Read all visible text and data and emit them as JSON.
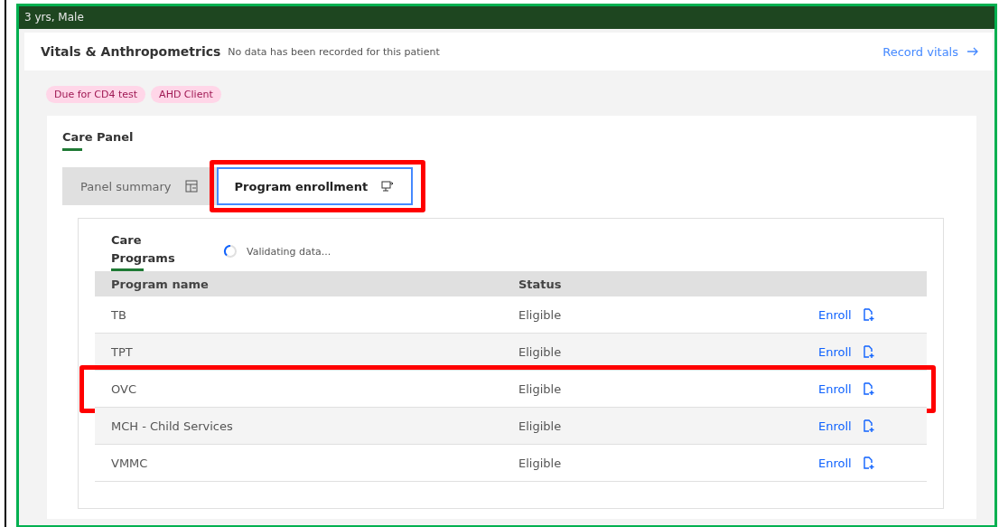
{
  "patient_banner": {
    "text": "3 yrs, Male"
  },
  "vitals": {
    "title": "Vitals & Anthropometrics",
    "message": "No data has been recorded for this patient",
    "link": "Record vitals"
  },
  "tags": [
    {
      "label": "Due for CD4 test"
    },
    {
      "label": "AHD Client"
    }
  ],
  "care_panel": {
    "title": "Care Panel",
    "tabs": [
      {
        "label": "Panel summary",
        "kind": "summary",
        "selected": false,
        "highlighted": false
      },
      {
        "label": "Program enrollment",
        "kind": "enrollment",
        "selected": true,
        "highlighted": true
      }
    ],
    "programs": {
      "title": "Care Programs",
      "loading": true,
      "loading_text": "Validating data...",
      "columns": [
        "Program name",
        "Status"
      ],
      "rows": [
        {
          "name": "TB",
          "status": "Eligible",
          "action": "Enroll",
          "highlighted": false
        },
        {
          "name": "TPT",
          "status": "Eligible",
          "action": "Enroll",
          "highlighted": false
        },
        {
          "name": "OVC",
          "status": "Eligible",
          "action": "Enroll",
          "highlighted": true
        },
        {
          "name": "MCH - Child Services",
          "status": "Eligible",
          "action": "Enroll",
          "highlighted": false
        },
        {
          "name": "VMMC",
          "status": "Eligible",
          "action": "Enroll",
          "highlighted": false
        }
      ]
    }
  }
}
